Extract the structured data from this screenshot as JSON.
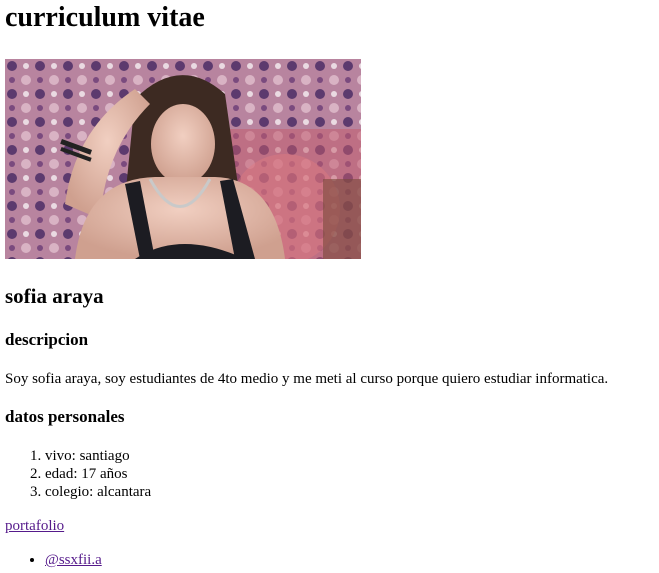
{
  "page": {
    "title": "curriculum vitae"
  },
  "profile": {
    "photo_alt": "foto",
    "name": "sofia araya"
  },
  "description": {
    "heading": "descripcion",
    "text": "Soy sofia araya, soy estudiantes de 4to medio y me meti al curso porque quiero estudiar informatica."
  },
  "personal_data": {
    "heading": "datos personales",
    "items": [
      "vivo: santiago",
      "edad: 17 años",
      "colegio: alcantara"
    ]
  },
  "links": {
    "portfolio_label": "portafolio",
    "social_items": [
      "@ssxfii.a"
    ]
  },
  "colors": {
    "visited_link": "#551a8b"
  }
}
